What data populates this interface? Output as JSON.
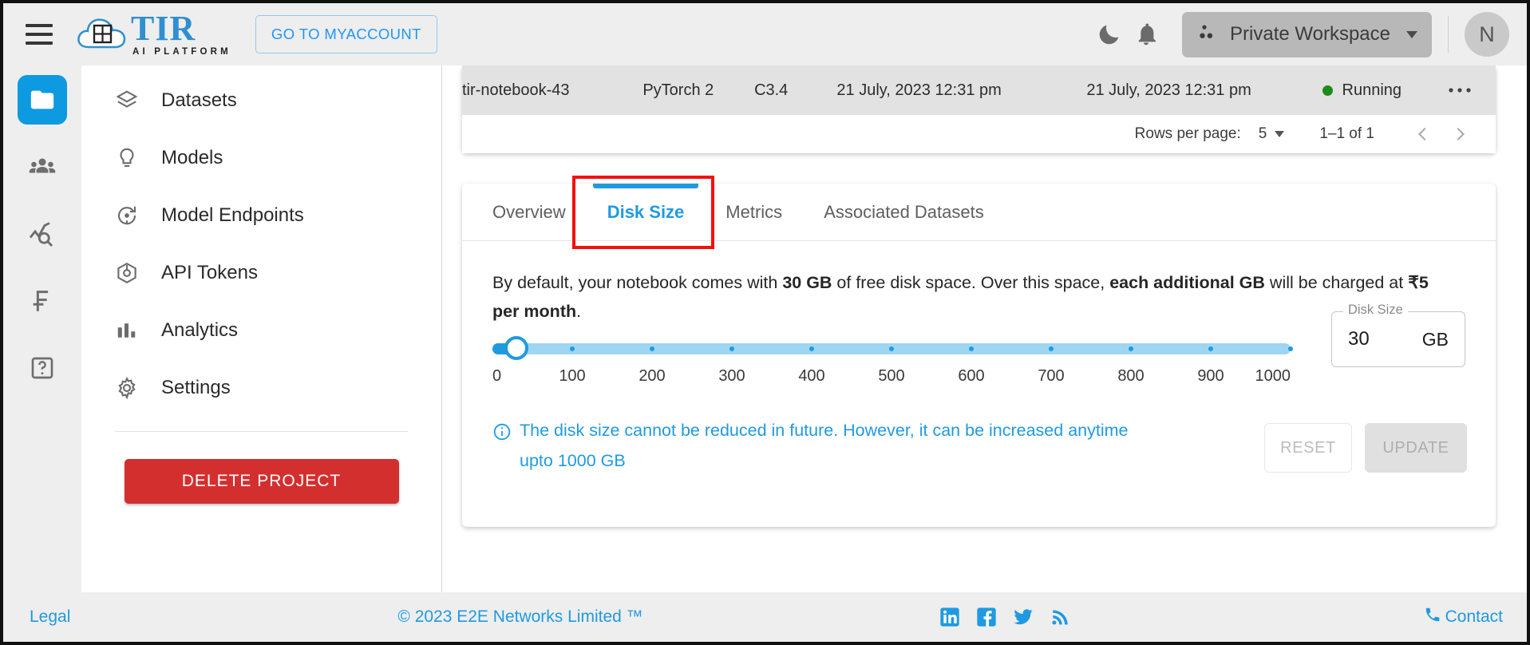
{
  "header": {
    "menu_icon": "hamburger-icon",
    "brand_name": "TIR",
    "brand_subtitle": "AI PLATFORM",
    "myaccount_label": "GO TO MYACCOUNT",
    "dark_mode_icon": "moon-icon",
    "notifications_icon": "bell-icon",
    "workspace_label": "Private Workspace",
    "workspace_icon": "workspace-icon",
    "avatar_initial": "N"
  },
  "rail": {
    "items": [
      {
        "icon": "folder-icon",
        "name": "projects",
        "active": true
      },
      {
        "icon": "team-icon",
        "name": "team",
        "active": false
      },
      {
        "icon": "monitoring-icon",
        "name": "monitoring",
        "active": false
      },
      {
        "icon": "billing-icon",
        "name": "billing",
        "active": false
      },
      {
        "icon": "help-icon",
        "name": "help",
        "active": false
      }
    ]
  },
  "sidebar": {
    "items": [
      {
        "label": "Datasets",
        "icon": "layers-icon"
      },
      {
        "label": "Models",
        "icon": "bulb-icon"
      },
      {
        "label": "Model Endpoints",
        "icon": "endpoint-icon"
      },
      {
        "label": "API Tokens",
        "icon": "cube-icon"
      },
      {
        "label": "Analytics",
        "icon": "bar-chart-icon"
      },
      {
        "label": "Settings",
        "icon": "gear-icon"
      }
    ],
    "delete_label": "DELETE PROJECT"
  },
  "notebook_table": {
    "row": {
      "name": "tir-notebook-43",
      "framework": "PyTorch 2",
      "plan": "C3.4",
      "created": "21 July, 2023 12:31 pm",
      "updated": "21 July, 2023 12:31 pm",
      "status": "Running",
      "status_color": "#1b8b1b",
      "more_icon": "more-horizontal-icon"
    },
    "pagination": {
      "rows_per_page_label": "Rows per page:",
      "rows_per_page_value": "5",
      "range": "1–1 of 1",
      "prev_icon": "chevron-left-icon",
      "next_icon": "chevron-right-icon"
    }
  },
  "tabs": {
    "items": [
      {
        "label": "Overview",
        "active": false
      },
      {
        "label": "Disk Size",
        "active": true
      },
      {
        "label": "Metrics",
        "active": false
      },
      {
        "label": "Associated Datasets",
        "active": false
      }
    ],
    "highlight_color": "#f60f0f"
  },
  "disk": {
    "description": {
      "p1": "By default, your notebook comes with ",
      "b1": "30 GB",
      "p2": " of free disk space. Over this space, ",
      "b2": "each additional GB",
      "p3": " will be charged at ",
      "b3": "₹5 per month",
      "p4": "."
    },
    "slider": {
      "min": 0,
      "max": 1000,
      "value": 30,
      "ticks": [
        "0",
        "100",
        "200",
        "300",
        "400",
        "500",
        "600",
        "700",
        "800",
        "900",
        "1000"
      ],
      "accent": "#1f9ae0",
      "track": "#9ed5f2"
    },
    "field": {
      "legend": "Disk Size",
      "value": "30",
      "unit": "GB"
    },
    "note": {
      "icon": "info-icon",
      "text": "The disk size cannot be reduced in future. However, it can be increased anytime upto 1000 GB"
    },
    "reset_label": "RESET",
    "update_label": "UPDATE"
  },
  "footer": {
    "legal": "Legal",
    "copyright": "© 2023 E2E Networks Limited ™",
    "social": [
      {
        "name": "linkedin-icon"
      },
      {
        "name": "facebook-icon"
      },
      {
        "name": "twitter-icon"
      },
      {
        "name": "rss-icon"
      }
    ],
    "contact_icon": "phone-icon",
    "contact": "Contact"
  }
}
